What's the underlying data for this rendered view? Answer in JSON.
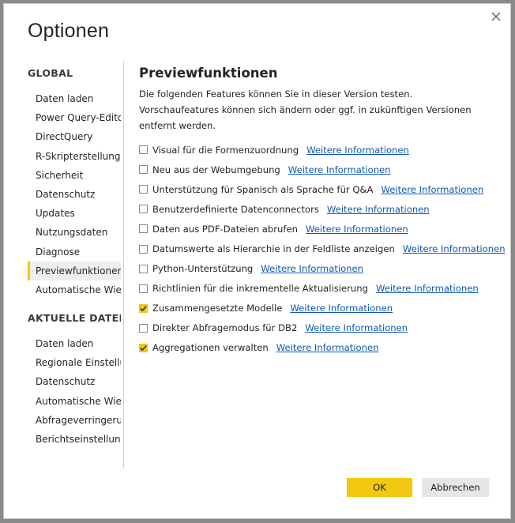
{
  "dialog": {
    "title": "Optionen"
  },
  "sidebar": {
    "groups": [
      {
        "heading": "GLOBAL",
        "items": [
          "Daten laden",
          "Power Query-Editor",
          "DirectQuery",
          "R-Skripterstellung",
          "Sicherheit",
          "Datenschutz",
          "Updates",
          "Nutzungsdaten",
          "Diagnose",
          "Previewfunktionen",
          "Automatische Wiederherstellung"
        ]
      },
      {
        "heading": "AKTUELLE DATEI",
        "items": [
          "Daten laden",
          "Regionale Einstellungen",
          "Datenschutz",
          "Automatische Wiederherstellung",
          "Abfrageverringerung",
          "Berichtseinstellungen"
        ]
      }
    ],
    "selected": "Previewfunktionen"
  },
  "content": {
    "title": "Previewfunktionen",
    "description": "Die folgenden Features können Sie in dieser Version testen. Vorschaufeatures können sich ändern oder ggf. in zukünftigen Versionen entfernt werden.",
    "link_text": "Weitere Informationen",
    "options": [
      {
        "label": "Visual für die Formenzuordnung",
        "checked": false
      },
      {
        "label": "Neu aus der Webumgebung",
        "checked": false
      },
      {
        "label": "Unterstützung für Spanisch als Sprache für Q&A",
        "checked": false
      },
      {
        "label": "Benutzerdefinierte Datenconnectors",
        "checked": false
      },
      {
        "label": "Daten aus PDF-Dateien abrufen",
        "checked": false
      },
      {
        "label": "Datumswerte als Hierarchie in der Feldliste anzeigen",
        "checked": false
      },
      {
        "label": "Python-Unterstützung",
        "checked": false
      },
      {
        "label": "Richtlinien für die inkrementelle Aktualisierung",
        "checked": false
      },
      {
        "label": "Zusammengesetzte Modelle",
        "checked": true
      },
      {
        "label": "Direkter Abfragemodus für DB2",
        "checked": false
      },
      {
        "label": "Aggregationen verwalten",
        "checked": true
      }
    ]
  },
  "buttons": {
    "ok": "OK",
    "cancel": "Abbrechen"
  },
  "colors": {
    "accent": "#f2c811",
    "link": "#0f58b3",
    "selected_bg": "#eeeeee"
  },
  "icons": {
    "close": "close-icon",
    "check": "checkmark-icon"
  }
}
